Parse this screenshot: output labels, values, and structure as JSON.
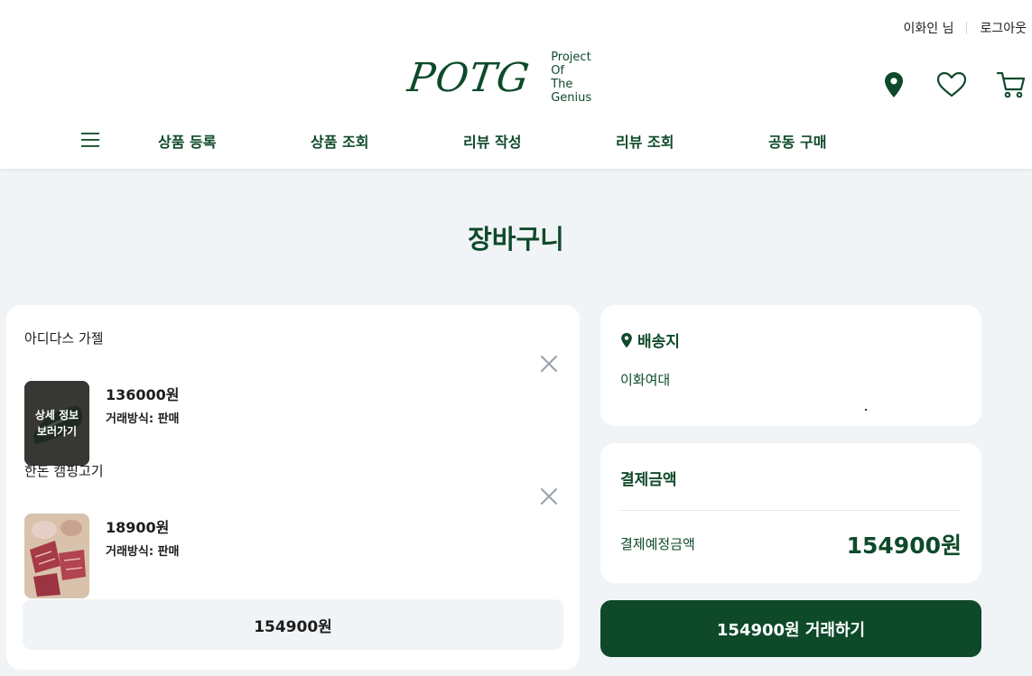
{
  "topbar": {
    "user": "이화인 님",
    "logout": "로그아웃"
  },
  "logo": {
    "mark": "POTG",
    "sub": [
      "Project",
      "Of",
      "The",
      "Genius"
    ]
  },
  "header_icons": [
    "location-icon",
    "heart-icon",
    "cart-icon"
  ],
  "nav": {
    "menu_icon": "hamburger-icon",
    "items": [
      "상품 등록",
      "상품 조회",
      "리뷰 작성",
      "리뷰 조회",
      "공동 구매"
    ]
  },
  "page": {
    "title": "장바구니"
  },
  "cart": {
    "items": [
      {
        "name": "아디다스 가젤",
        "price": "136000원",
        "trade": "거래방식: 판매",
        "thumb_overlay": [
          "상세 정보",
          "보러가기"
        ]
      },
      {
        "name": "한돈 캠핑고기",
        "price": "18900원",
        "trade": "거래방식: 판매"
      }
    ],
    "total": "154900원"
  },
  "shipping": {
    "title": "배송지",
    "address": "이화여대"
  },
  "payment": {
    "title": "결제금액",
    "label": "결제예정금액",
    "amount": "154900원"
  },
  "checkout": {
    "label": "154900원 거래하기"
  },
  "colors": {
    "brand": "#0e4a2a",
    "background": "#f1f4f7",
    "card": "#ffffff"
  }
}
